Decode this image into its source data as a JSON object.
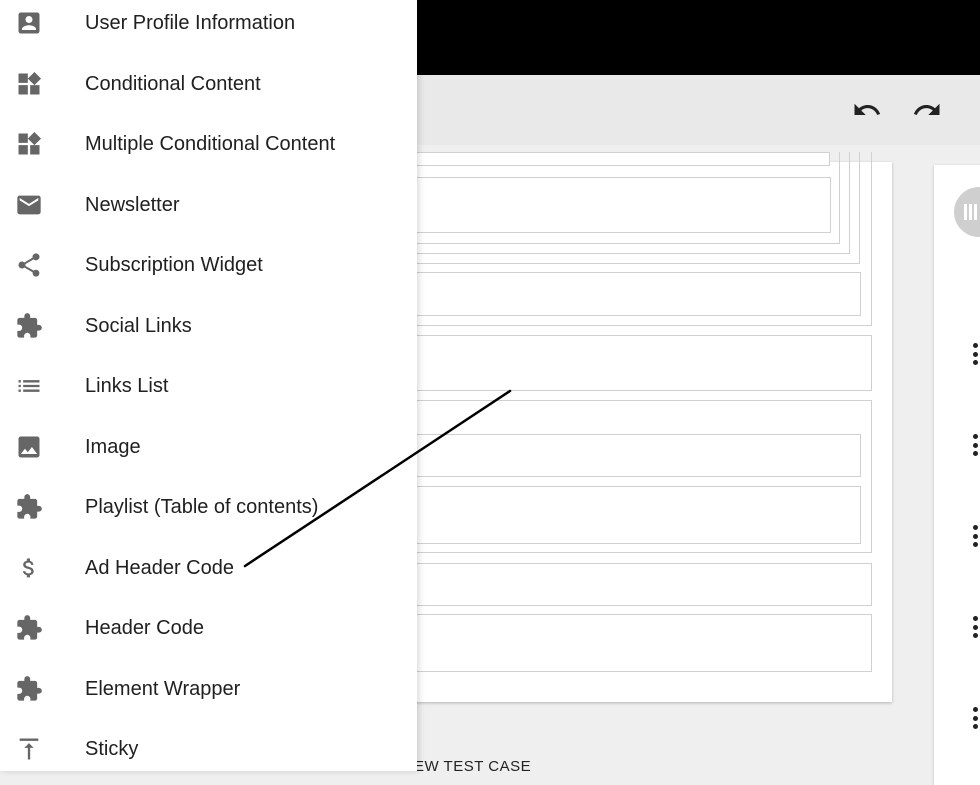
{
  "toolbar": {
    "undo_icon": "undo-icon",
    "redo_icon": "redo-icon"
  },
  "drawer": {
    "items": [
      {
        "label": "User Profile Information",
        "icon": "account-box-icon"
      },
      {
        "label": "Conditional Content",
        "icon": "widgets-icon"
      },
      {
        "label": "Multiple Conditional Content",
        "icon": "widgets-icon"
      },
      {
        "label": "Newsletter",
        "icon": "mail-icon"
      },
      {
        "label": "Subscription Widget",
        "icon": "share-icon"
      },
      {
        "label": "Social Links",
        "icon": "puzzle-icon"
      },
      {
        "label": "Links List",
        "icon": "list-icon"
      },
      {
        "label": "Image",
        "icon": "image-icon"
      },
      {
        "label": "Playlist (Table of contents)",
        "icon": "puzzle-icon"
      },
      {
        "label": "Ad Header Code",
        "icon": "dollar-icon"
      },
      {
        "label": "Header Code",
        "icon": "puzzle-icon"
      },
      {
        "label": "Element Wrapper",
        "icon": "puzzle-icon"
      },
      {
        "label": "Sticky",
        "icon": "vertical-align-top-icon"
      }
    ]
  },
  "bottom": {
    "partial_text": "EW TEST CASE"
  },
  "colors": {
    "top_bar": "#000000",
    "icon": "#666666",
    "text": "#202020",
    "background": "#efefef"
  }
}
